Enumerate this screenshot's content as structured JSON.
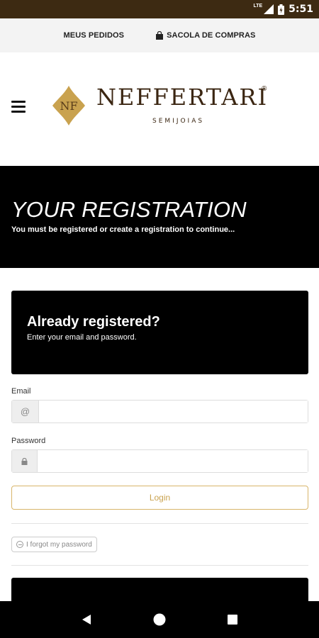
{
  "status_bar": {
    "time": "5:51",
    "network": "LTE"
  },
  "top_links": {
    "orders": "MEUS PEDIDOS",
    "bag": "SACOLA DE COMPRAS"
  },
  "brand": {
    "name": "NEFFERTARI",
    "registered": "®",
    "tagline": "SEMIJOIAS",
    "monogram": "NF",
    "color": "#3b2612",
    "gold": "#c9a24f"
  },
  "hero": {
    "title": "YOUR REGISTRATION",
    "subtitle": "You must be registered or create a registration to continue..."
  },
  "login": {
    "title": "Already registered?",
    "subtitle": "Enter your email and password.",
    "email_label": "Email",
    "email_icon": "@",
    "email_value": "",
    "password_label": "Password",
    "password_value": "",
    "button": "Login",
    "forgot": "I forgot my password"
  },
  "icons": [
    "menu-icon",
    "bag-icon",
    "at-icon",
    "lock-icon",
    "info-icon",
    "back-icon",
    "home-icon",
    "recents-icon",
    "signal-icon",
    "battery-icon"
  ]
}
